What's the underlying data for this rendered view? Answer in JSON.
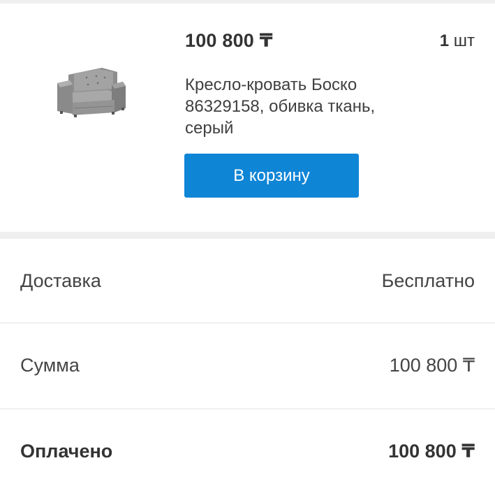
{
  "product": {
    "price": "100 800 ₸",
    "quantity_number": "1",
    "quantity_unit": "шт",
    "name": "Кресло-кровать Боско 86329158, обивка ткань, серый",
    "image_icon": "armchair-image",
    "cart_button_label": "В корзину",
    "accent_color": "#0f85d6"
  },
  "summary": {
    "delivery": {
      "label": "Доставка",
      "value": "Бесплатно"
    },
    "sum": {
      "label": "Сумма",
      "value": "100 800 ₸"
    },
    "paid": {
      "label": "Оплачено",
      "value": "100 800 ₸"
    }
  }
}
